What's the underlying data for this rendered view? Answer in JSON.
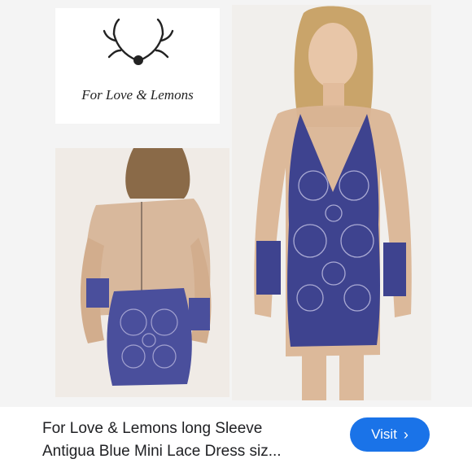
{
  "brand": {
    "logo_text": "For Love & Lemons"
  },
  "product": {
    "title_line1": "For Love & Lemons long Sleeve",
    "title_line2": "Antigua Blue Mini Lace Dress siz..."
  },
  "actions": {
    "visit_label": "Visit",
    "visit_icon": "chevron-right-icon"
  },
  "colors": {
    "accent": "#1a73e8",
    "lace": "#3b3f8f",
    "skin": "#d9b69a"
  }
}
